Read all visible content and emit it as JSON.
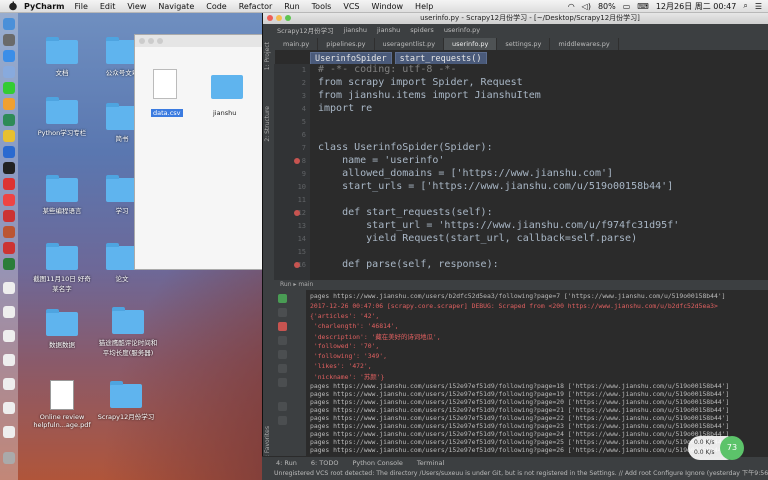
{
  "menubar": {
    "app": "PyCharm",
    "items": [
      "File",
      "Edit",
      "View",
      "Navigate",
      "Code",
      "Refactor",
      "Run",
      "Tools",
      "VCS",
      "Window",
      "Help"
    ],
    "battery": "80%",
    "datetime": "12月26日 周二  00:47"
  },
  "desktop": {
    "folders": [
      {
        "label": "文档"
      },
      {
        "label": "公众号文章"
      },
      {
        "label": "Python学习专栏"
      },
      {
        "label": "简书"
      },
      {
        "label": "某些编程语言"
      },
      {
        "label": "学习"
      },
      {
        "label": "截图11月10日 好奇 某名字"
      },
      {
        "label": "论文"
      },
      {
        "label": "数据数据"
      },
      {
        "label": "猫途鹰酷评论时间和平均长度(服务器)"
      },
      {
        "label": "Online review helpfuln...age.pdf"
      },
      {
        "label": "Scrapy12月份学习"
      }
    ],
    "finder": {
      "files": [
        {
          "label": "data.csv"
        },
        {
          "label": "jianshu"
        }
      ]
    }
  },
  "pycharm": {
    "window_title": "userinfo.py - Scrapy12月份学习 - [~/Desktop/Scrapy12月份学习]",
    "navbar": [
      "Scrapy12月份学习",
      "jianshu",
      "jianshu",
      "spiders",
      "userinfo.py"
    ],
    "tabs": [
      "main.py",
      "pipelines.py",
      "useragentlist.py",
      "userinfo.py",
      "settings.py",
      "middlewares.py"
    ],
    "active_tab": "userinfo.py",
    "breadcrumbs": [
      "UserinfoSpider",
      "start_requests()"
    ],
    "left_tool_tabs": [
      "1: Project",
      "2: Structure",
      "2: Favorites"
    ],
    "editor_lines": [
      {
        "n": "1",
        "text": "# -*- coding: utf-8 -*-"
      },
      {
        "n": "2",
        "text": "from scrapy import Spider, Request"
      },
      {
        "n": "3",
        "text": "from jianshu.items import JianshuItem"
      },
      {
        "n": "4",
        "text": "import re"
      },
      {
        "n": "5",
        "text": ""
      },
      {
        "n": "6",
        "text": ""
      },
      {
        "n": "7",
        "text": "class UserinfoSpider(Spider):"
      },
      {
        "n": "8",
        "text": "    name = 'userinfo'"
      },
      {
        "n": "9",
        "text": "    allowed_domains = ['https://www.jianshu.com']"
      },
      {
        "n": "10",
        "text": "    start_urls = ['https://www.jianshu.com/u/519o00158b44']"
      },
      {
        "n": "11",
        "text": ""
      },
      {
        "n": "12",
        "text": "    def start_requests(self):"
      },
      {
        "n": "13",
        "text": "        start_url = 'https://www.jianshu.com/u/f974fc31d95f'"
      },
      {
        "n": "14",
        "text": "        yield Request(start_url, callback=self.parse)"
      },
      {
        "n": "15",
        "text": ""
      },
      {
        "n": "16",
        "text": "    def parse(self, response):"
      }
    ],
    "run_header": "Run  ▸ main",
    "console_lines": [
      "pages https://www.jianshu.com/users/b2dfc52d5ea3/following?page=7 ['https://www.jianshu.com/u/519o00158b44']",
      "2017-12-26 00:47:06 [scrapy.core.scraper] DEBUG: Scraped from <200 https://www.jianshu.com/u/b2dfc52d5ea3>",
      "{'articles': '42',",
      " 'charlength': '46814',",
      " 'description': '藏在美好的诗词地瓜',",
      " 'followed': '70',",
      " 'following': '349',",
      " 'likes': '472',",
      " 'nickname': '苏颜'}",
      "pages https://www.jianshu.com/users/152e97ef51d9/following?page=18 ['https://www.jianshu.com/u/519o00158b44']",
      "pages https://www.jianshu.com/users/152e97ef51d9/following?page=19 ['https://www.jianshu.com/u/519o00158b44']",
      "pages https://www.jianshu.com/users/152e97ef51d9/following?page=20 ['https://www.jianshu.com/u/519o00158b44']",
      "pages https://www.jianshu.com/users/152e97ef51d9/following?page=21 ['https://www.jianshu.com/u/519o00158b44']",
      "pages https://www.jianshu.com/users/152e97ef51d9/following?page=22 ['https://www.jianshu.com/u/519o00158b44']",
      "pages https://www.jianshu.com/users/152e97ef51d9/following?page=23 ['https://www.jianshu.com/u/519o00158b44']",
      "pages https://www.jianshu.com/users/152e97ef51d9/following?page=24 ['https://www.jianshu.com/u/519o00158b44']",
      "pages https://www.jianshu.com/users/152e97ef51d9/following?page=25 ['https://www.jianshu.com/u/519o00158b44']",
      "pages https://www.jianshu.com/users/152e97ef51d9/following?page=26 ['https://www.jianshu.com/u/519o00158b44']",
      "pages https://www.jianshu.com/users/152e97ef51d9/following?page=27 ['https://www.jianshu.com/u/519o00158b44']"
    ],
    "bottom_tabs": [
      "4: Run",
      "6: TODO",
      "Python Console",
      "Terminal"
    ],
    "status_text": "Unregistered VCS root detected: The directory /Users/suxeuu is under Git, but is not registered in the Settings. // Add root  Configure  Ignore (yesterday 下午9:56)"
  },
  "net_widget": {
    "up": "0.0 K/s",
    "down": "0.0 K/s",
    "percent": "73"
  }
}
